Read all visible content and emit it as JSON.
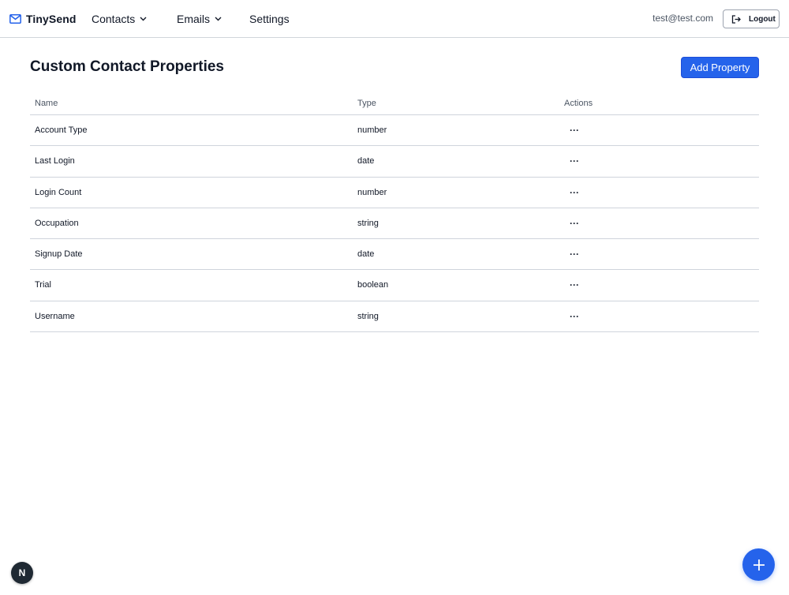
{
  "app": {
    "brand": "TinySend",
    "brand_icon": "mail-icon",
    "accent_color": "#2563eb"
  },
  "nav": {
    "contacts_label": "Contacts",
    "emails_label": "Emails",
    "settings_label": "Settings"
  },
  "user": {
    "email": "test@test.com",
    "logout_label": "Logout"
  },
  "main": {
    "title": "Custom Contact Properties",
    "add_button_label": "Add Property"
  },
  "table": {
    "headers": {
      "name": "Name",
      "type": "Type",
      "actions": "Actions"
    },
    "rows": [
      {
        "name": "Account Type",
        "type": "number",
        "actions": "···"
      },
      {
        "name": "Last Login",
        "type": "date",
        "actions": "···"
      },
      {
        "name": "Login Count",
        "type": "number",
        "actions": "···"
      },
      {
        "name": "Occupation",
        "type": "string",
        "actions": "···"
      },
      {
        "name": "Signup Date",
        "type": "date",
        "actions": "···"
      },
      {
        "name": "Trial",
        "type": "boolean",
        "actions": "···"
      },
      {
        "name": "Username",
        "type": "string",
        "actions": "···"
      }
    ]
  },
  "widgets": {
    "dev_badge_label": "N",
    "fab_icon": "plus-icon"
  }
}
